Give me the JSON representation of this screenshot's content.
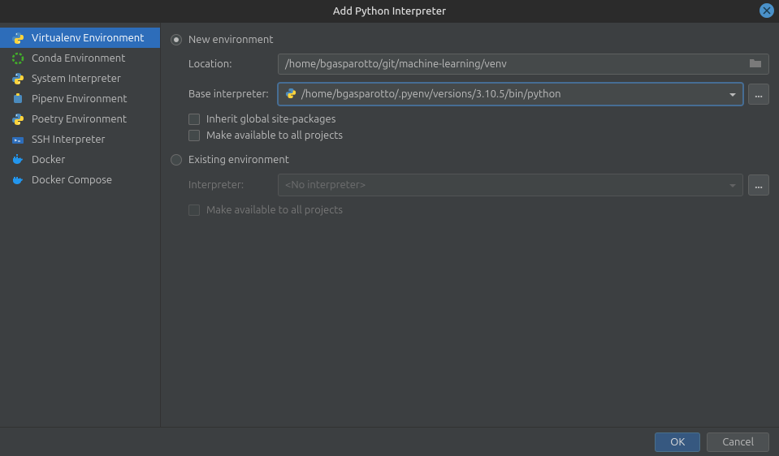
{
  "title": "Add Python Interpreter",
  "sidebar": {
    "items": [
      {
        "label": "Virtualenv Environment"
      },
      {
        "label": "Conda Environment"
      },
      {
        "label": "System Interpreter"
      },
      {
        "label": "Pipenv Environment"
      },
      {
        "label": "Poetry Environment"
      },
      {
        "label": "SSH Interpreter"
      },
      {
        "label": "Docker"
      },
      {
        "label": "Docker Compose"
      }
    ]
  },
  "main": {
    "newEnv": "New environment",
    "existingEnv": "Existing environment",
    "locationLabel": "Location:",
    "locationValue": "/home/bgasparotto/git/machine-learning/venv",
    "baseInterpLabel": "Base interpreter:",
    "baseInterpValue": "/home/bgasparotto/.pyenv/versions/3.10.5/bin/python",
    "inheritLabel": "Inherit global site-packages",
    "availLabel": "Make available to all projects",
    "interpLabel": "Interpreter:",
    "noInterp": "<No interpreter>",
    "availLabel2": "Make available to all projects",
    "browseLabel": "..."
  },
  "buttons": {
    "ok": "OK",
    "cancel": "Cancel"
  }
}
